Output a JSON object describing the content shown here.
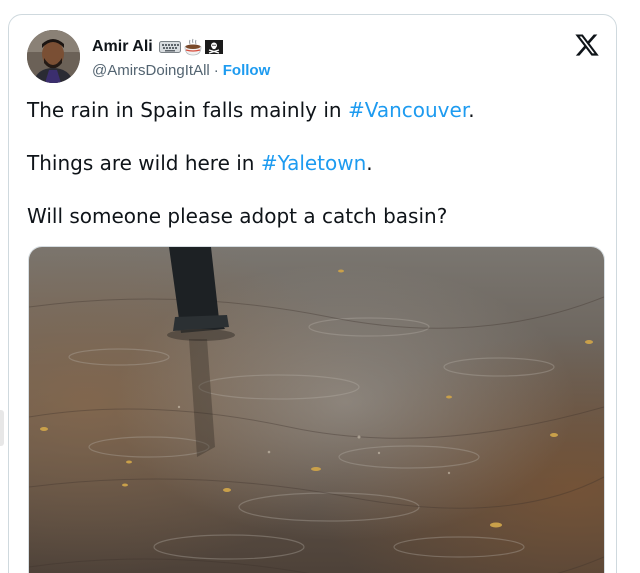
{
  "author": {
    "display_name": "Amir Ali",
    "handle": "@AmirsDoingItAll",
    "separator": "·",
    "follow_label": "Follow",
    "badge_icons": [
      "keyboard-icon",
      "coffee-icon",
      "pirate-flag-icon"
    ]
  },
  "tweet": {
    "line1_text": "The rain in Spain falls mainly in ",
    "line1_hashtag": "#Vancouver",
    "line1_end": ".",
    "line2_text": "Things are wild here in ",
    "line2_hashtag": "#Yaletown",
    "line2_end": ".",
    "line3_text": "Will someone please adopt a catch basin?"
  },
  "media": {
    "description_icon": "flooded-street-photo"
  },
  "colors": {
    "link": "#1d9bf0",
    "text": "#0f1419",
    "secondary": "#536471",
    "border": "#cfd9de"
  }
}
